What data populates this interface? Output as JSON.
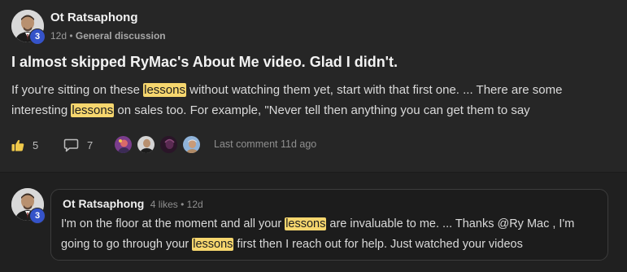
{
  "post": {
    "author": {
      "name": "Ot Ratsaphong",
      "level": "3"
    },
    "meta": {
      "age": "12d",
      "separator": "•",
      "category": "General discussion"
    },
    "title": "I almost skipped RyMac's About Me video. Glad I didn't.",
    "body": [
      {
        "text": "If you're sitting on these "
      },
      {
        "text": "lessons",
        "highlight": true
      },
      {
        "text": " without watching them yet, start with that first one. ... There are some interesting "
      },
      {
        "text": "lessons",
        "highlight": true
      },
      {
        "text": " on sales too. For example, \"Never tell then anything you can get them to say"
      }
    ],
    "actions": {
      "like_icon": "thumbs-up-icon",
      "likes": "5",
      "comment_icon": "comment-icon",
      "comments": "7"
    },
    "participants": [
      {
        "name": "participant-1",
        "color": "#7a3d8c"
      },
      {
        "name": "participant-2",
        "color": "#c8c8c8"
      },
      {
        "name": "participant-3",
        "color": "#3a1a3a"
      },
      {
        "name": "participant-4",
        "color": "#8fb3d9"
      }
    ],
    "last_comment": "Last comment 11d ago"
  },
  "comment": {
    "author": {
      "name": "Ot Ratsaphong",
      "level": "3"
    },
    "meta": "4 likes • 12d",
    "body": [
      {
        "text": "I'm on the floor at the moment and all your "
      },
      {
        "text": "lessons",
        "highlight": true
      },
      {
        "text": " are invaluable to me. ... Thanks @Ry Mac , I'm going to go through your "
      },
      {
        "text": "lessons",
        "highlight": true
      },
      {
        "text": " first then I reach out for help. Just watched your videos"
      }
    ]
  },
  "colors": {
    "background": "#202020",
    "card": "#262626",
    "highlight": "#f6d66e",
    "level_badge": "#3553c9",
    "comment_bubble": "#1c1c1c"
  }
}
